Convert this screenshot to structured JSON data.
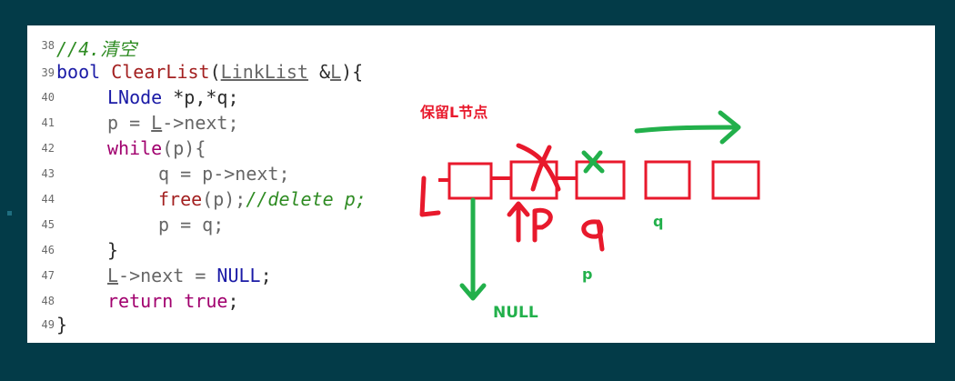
{
  "code": {
    "line_numbers": [
      "38",
      "39",
      "40",
      "41",
      "42",
      "43",
      "44",
      "45",
      "46",
      "47",
      "48",
      "49"
    ],
    "comment_heading": "//4.清空",
    "bool_kw": "bool",
    "fn_name": "ClearList",
    "paren_open": "(",
    "param_type": "LinkList",
    "amp": "&",
    "param_name": "L",
    "sig_close": "){",
    "lnode": "LNode",
    "decl_vars": "*p,*q;",
    "p_assign": "p = ",
    "L": "L",
    "next_semicolon": "->next;",
    "while_kw": "while",
    "while_cond": "(p){",
    "q_assign": "q = p->next;",
    "free_fn": "free",
    "free_arg": "(p);",
    "free_comment": "//delete p;",
    "p_eq_q": "p = q;",
    "close_brace": "}",
    "next_null": "->next = ",
    "null_kw": "NULL",
    "semicolon": ";",
    "return_kw": "return",
    "true_kw": "true",
    "end_brace": "}",
    "partial": "..."
  },
  "annotations": {
    "keep_L": "保留L节点",
    "NULL": "NULL",
    "p_green": "p",
    "q_green": "q"
  },
  "colors": {
    "background": "#033b48",
    "panel": "#ffffff",
    "red_ink": "#e8192c",
    "green_ink": "#22b04b"
  }
}
